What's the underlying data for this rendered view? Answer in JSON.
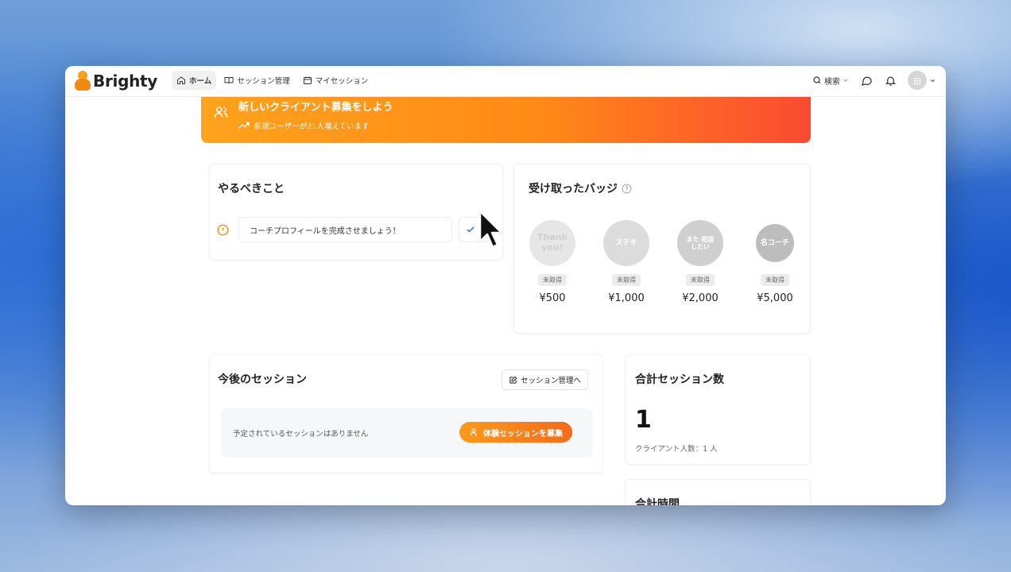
{
  "app": {
    "name": "Brighty"
  },
  "nav": {
    "items": [
      {
        "label": "ホーム",
        "icon": "home-icon",
        "active": true
      },
      {
        "label": "セッション管理",
        "icon": "book-icon",
        "active": false
      },
      {
        "label": "マイセッション",
        "icon": "calendar-icon",
        "active": false
      }
    ],
    "search_label": "検索",
    "avatar_initial": "田"
  },
  "banner": {
    "title": "新しいクライアント募集をしよう",
    "subtitle": "新規ユーザーが21人増えています"
  },
  "todo": {
    "title": "やるべきこと",
    "items": [
      {
        "label": "コーチプロフィールを完成させましょう！"
      }
    ]
  },
  "badges": {
    "title": "受け取ったバッジ",
    "items": [
      {
        "label": "Thank you!",
        "status": "未取得",
        "price": "¥500",
        "color": "#e6e6e6"
      },
      {
        "label": "ステキ",
        "status": "未取得",
        "price": "¥1,000",
        "color": "#dcdcdc"
      },
      {
        "label": "また 相談したい",
        "status": "未取得",
        "price": "¥2,000",
        "color": "#cfcfcf"
      },
      {
        "label": "名コーチ",
        "status": "未取得",
        "price": "¥5,000",
        "color": "#bdbdbd"
      }
    ]
  },
  "sessions": {
    "title": "今後のセッション",
    "manage_label": "セッション管理へ",
    "empty_text": "予定されているセッションはありません",
    "recruit_label": "体験セッションを募集"
  },
  "stats": {
    "total_sessions_title": "合計セッション数",
    "total_sessions_value": "1",
    "clients_label": "クライアント人数：1 人",
    "total_time_title": "合計時間"
  },
  "colors": {
    "accent": "#ff8a17",
    "accent_red": "#fb4a32"
  }
}
